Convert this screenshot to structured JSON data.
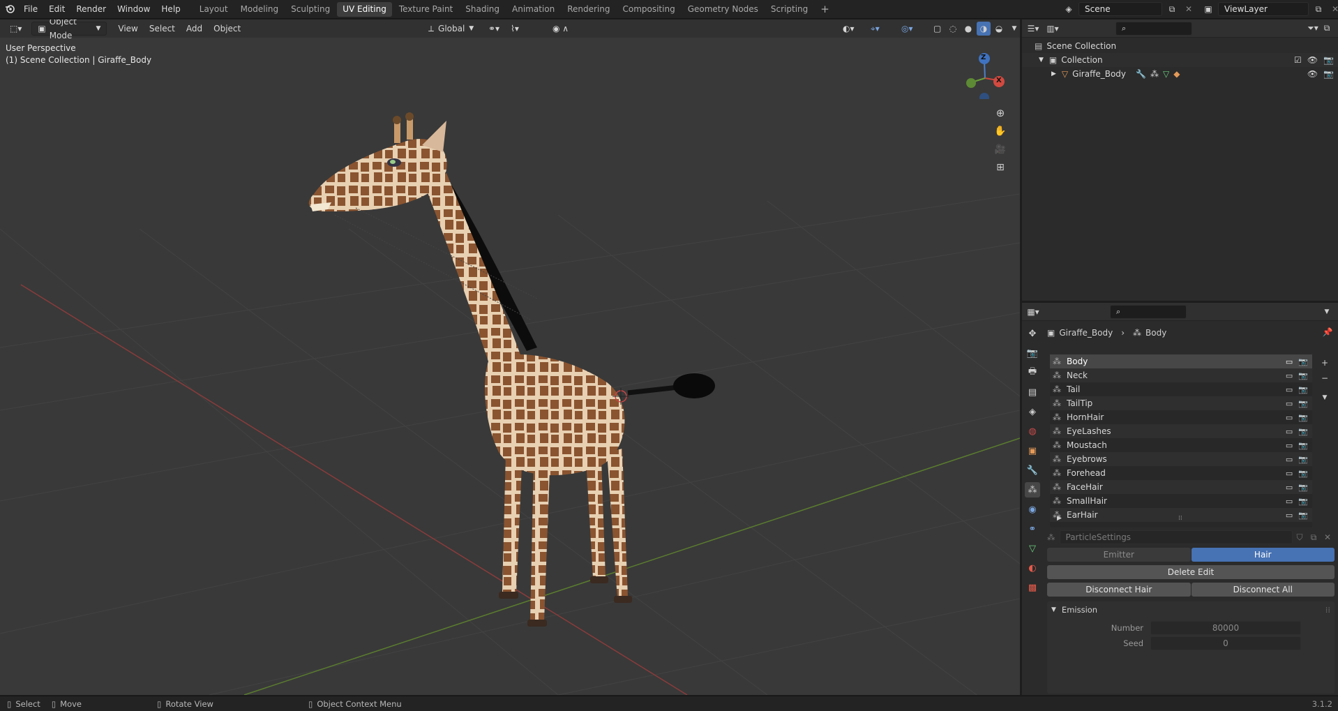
{
  "menus": [
    "File",
    "Edit",
    "Render",
    "Window",
    "Help"
  ],
  "workspaces": [
    {
      "label": "Layout",
      "active": false
    },
    {
      "label": "Modeling",
      "active": false
    },
    {
      "label": "Sculpting",
      "active": false
    },
    {
      "label": "UV Editing",
      "active": true
    },
    {
      "label": "Texture Paint",
      "active": false
    },
    {
      "label": "Shading",
      "active": false
    },
    {
      "label": "Animation",
      "active": false
    },
    {
      "label": "Rendering",
      "active": false
    },
    {
      "label": "Compositing",
      "active": false
    },
    {
      "label": "Geometry Nodes",
      "active": false
    },
    {
      "label": "Scripting",
      "active": false
    }
  ],
  "scene": {
    "name": "Scene",
    "view_layer": "ViewLayer"
  },
  "viewport": {
    "mode": "Object Mode",
    "menus": [
      "View",
      "Select",
      "Add",
      "Object"
    ],
    "transform": "Global",
    "overlay_text": "User Perspective",
    "overlay_sub": "(1) Scene Collection | Giraffe_Body",
    "gizmo": {
      "z": "Z",
      "x": "X"
    }
  },
  "outliner": {
    "search_placeholder": "",
    "scene_collection": "Scene Collection",
    "collection": "Collection",
    "object": "Giraffe_Body"
  },
  "properties": {
    "breadcrumb_object": "Giraffe_Body",
    "breadcrumb_system": "Body",
    "particle_systems": [
      "Body",
      "Neck",
      "Tail",
      "TailTip",
      "HornHair",
      "EyeLashes",
      "Moustach",
      "Eyebrows",
      "Forehead",
      "FaceHair",
      "SmallHair",
      "EarHair"
    ],
    "selected_index": 0,
    "settings_name": "ParticleSettings",
    "type_emitter": "Emitter",
    "type_hair": "Hair",
    "delete_edit": "Delete Edit",
    "disconnect_hair": "Disconnect Hair",
    "disconnect_all": "Disconnect All",
    "emission_title": "Emission",
    "number_label": "Number",
    "number_value": "80000",
    "seed_label": "Seed",
    "seed_value": "0"
  },
  "status": {
    "select": "Select",
    "move": "Move",
    "rotate": "Rotate View",
    "context": "Object Context Menu",
    "version": "3.1.2"
  },
  "colors": {
    "accent": "#4772b3",
    "active_tab": "#3d3d3d",
    "viewport_bg": "#393939"
  }
}
